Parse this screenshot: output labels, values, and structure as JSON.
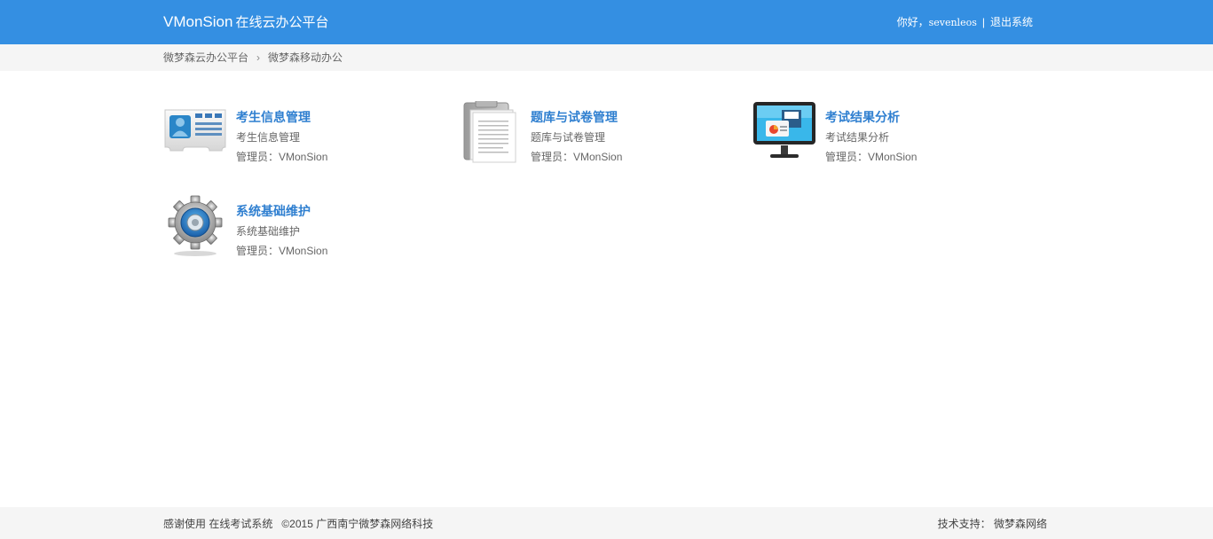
{
  "header": {
    "brand_en": "VMonSion",
    "brand_cn": "在线云办公平台",
    "greeting": "你好，",
    "username": "sevenleos",
    "separator": "|",
    "logout_label": "退出系统"
  },
  "breadcrumb": {
    "items": [
      "微梦森云办公平台",
      "微梦森移动办公"
    ],
    "separator": "›"
  },
  "apps": [
    {
      "title": "考生信息管理",
      "desc": "考生信息管理",
      "admin": "管理员：VMonSion",
      "icon": "id-card-icon"
    },
    {
      "title": "题库与试卷管理",
      "desc": "题库与试卷管理",
      "admin": "管理员：VMonSion",
      "icon": "clipboard-icon"
    },
    {
      "title": "考试结果分析",
      "desc": "考试结果分析",
      "admin": "管理员：VMonSion",
      "icon": "monitor-chart-icon"
    },
    {
      "title": "系统基础维护",
      "desc": "系统基础维护",
      "admin": "管理员：VMonSion",
      "icon": "gear-icon"
    }
  ],
  "footer": {
    "thanks": "感谢使用 在线考试系统",
    "copyright": "©2015 广西南宁微梦森网络科技",
    "support": "技术支持： 微梦森网络"
  },
  "colors": {
    "header_bg": "#348fe2",
    "title_link": "#2f7fd0",
    "bar_bg": "#f5f5f5"
  }
}
